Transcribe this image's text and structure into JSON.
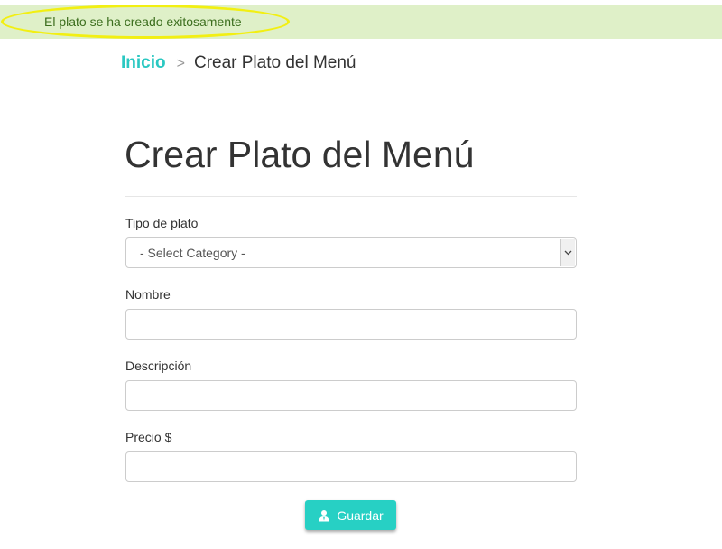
{
  "alert": {
    "message": "El plato se ha creado exitosamente"
  },
  "breadcrumb": {
    "home": "Inicio",
    "separator": ">",
    "current": "Crear Plato del Menú"
  },
  "page": {
    "title": "Crear Plato del Menú"
  },
  "form": {
    "tipo_label": "Tipo de plato",
    "tipo_selected": "- Select Category -",
    "nombre_label": "Nombre",
    "nombre_value": "",
    "descripcion_label": "Descripción",
    "descripcion_value": "",
    "precio_label": "Precio $",
    "precio_value": "",
    "submit_label": "Guardar",
    "submit_icon": "user-tie-icon"
  },
  "colors": {
    "accent": "#2bc8c2",
    "button": "#27d0c4",
    "alert_bg": "#dff0c8",
    "alert_text": "#3c6e1e",
    "highlight": "#f2ef12"
  }
}
